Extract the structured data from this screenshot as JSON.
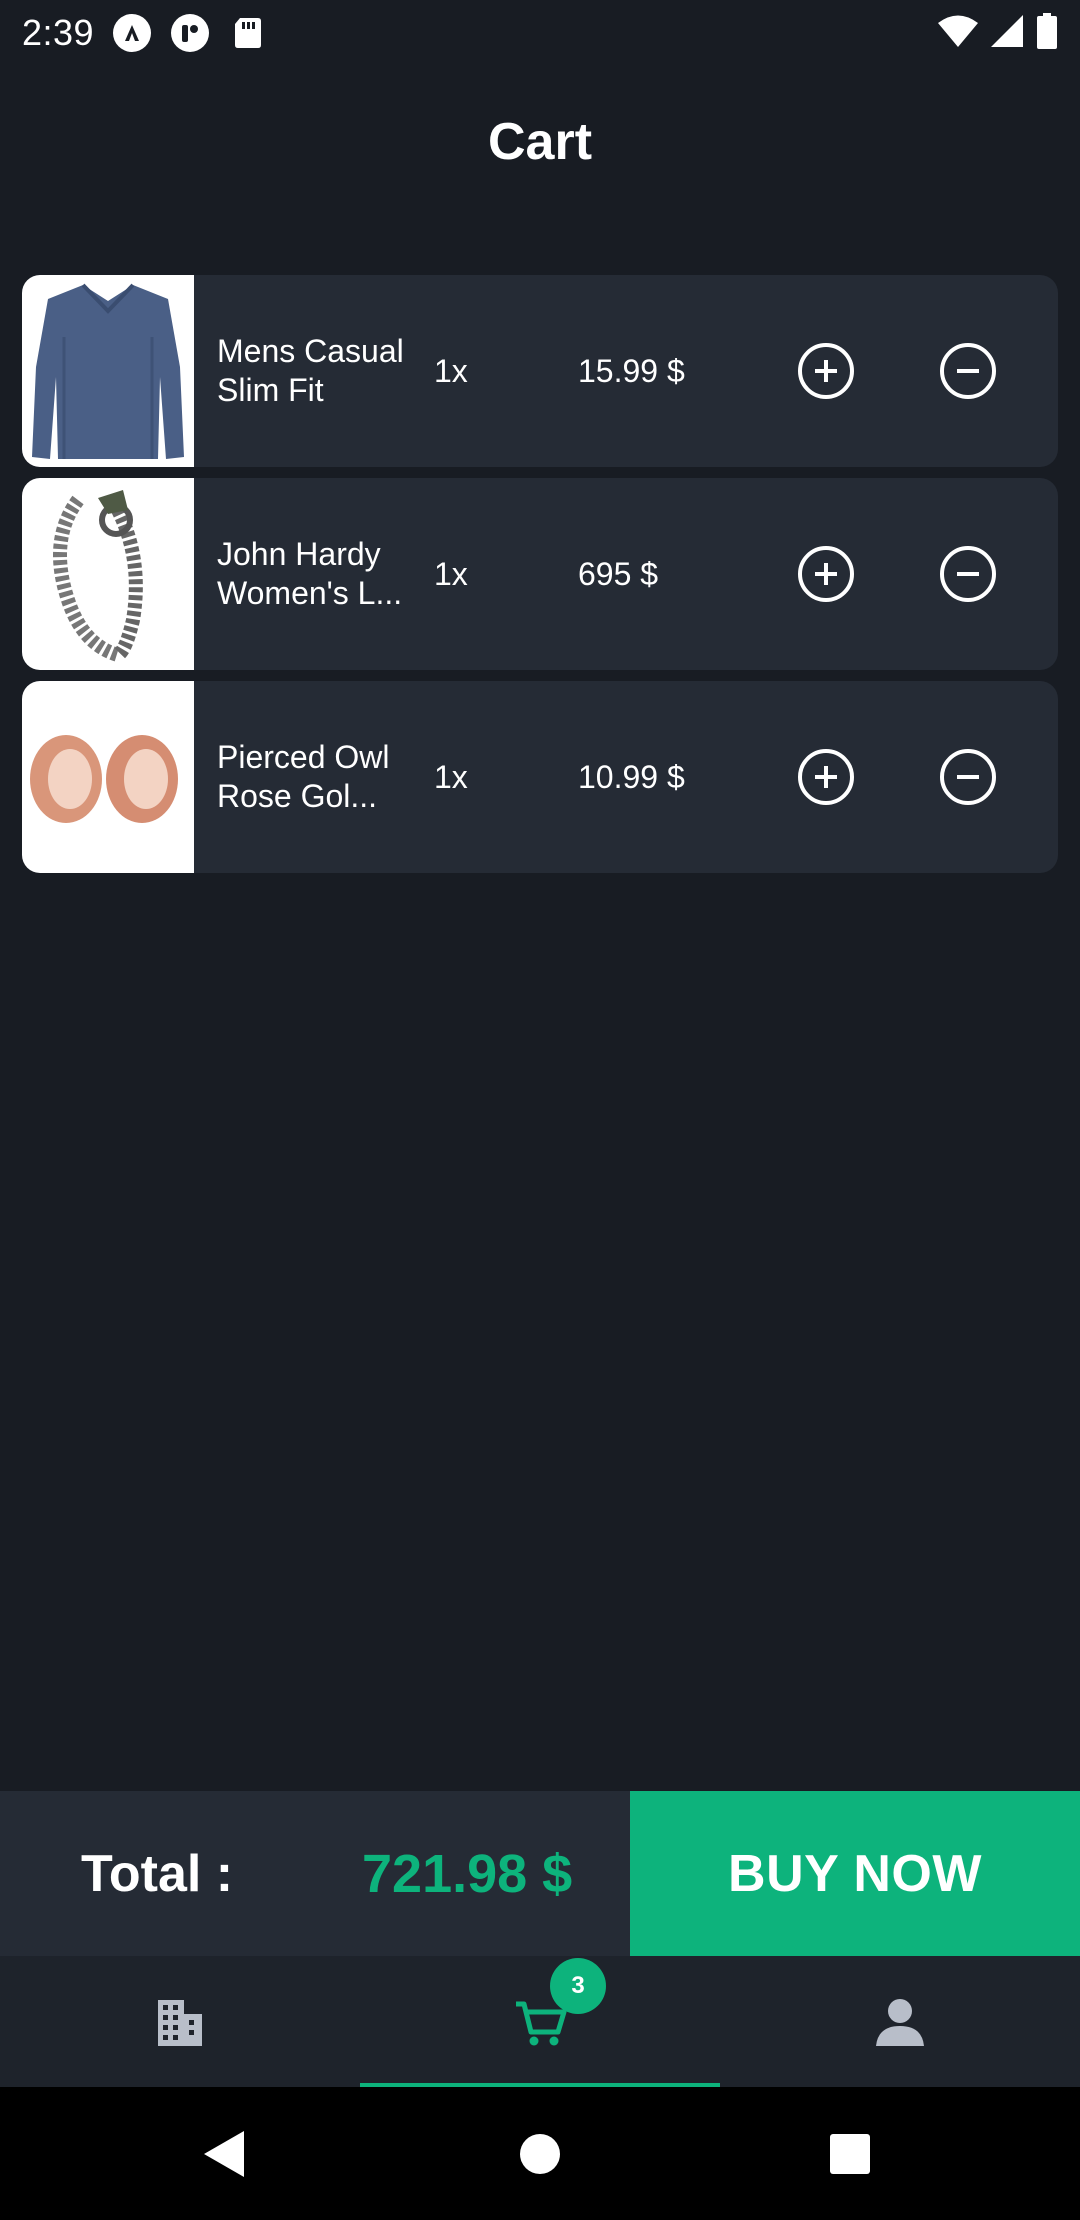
{
  "status_bar": {
    "time": "2:39"
  },
  "page": {
    "title": "Cart"
  },
  "cart": {
    "items": [
      {
        "name": "Mens Casual Slim Fit",
        "quantity": "1x",
        "price": "15.99 $",
        "image_icon": "shirt-image"
      },
      {
        "name": "John Hardy Women's L...",
        "quantity": "1x",
        "price": "695 $",
        "image_icon": "bracelet-image"
      },
      {
        "name": "Pierced Owl Rose Gol...",
        "quantity": "1x",
        "price": "10.99 $",
        "image_icon": "earrings-image"
      }
    ]
  },
  "checkout": {
    "total_label": "Total :",
    "total_value": "721.98 $",
    "buy_label": "BUY NOW"
  },
  "bottom_nav": {
    "tabs": [
      {
        "icon": "building-icon",
        "active": false
      },
      {
        "icon": "cart-icon",
        "active": true,
        "badge": "3"
      },
      {
        "icon": "person-icon",
        "active": false
      }
    ]
  },
  "colors": {
    "background": "#181c23",
    "card": "#252b35",
    "accent": "#0db37c"
  }
}
